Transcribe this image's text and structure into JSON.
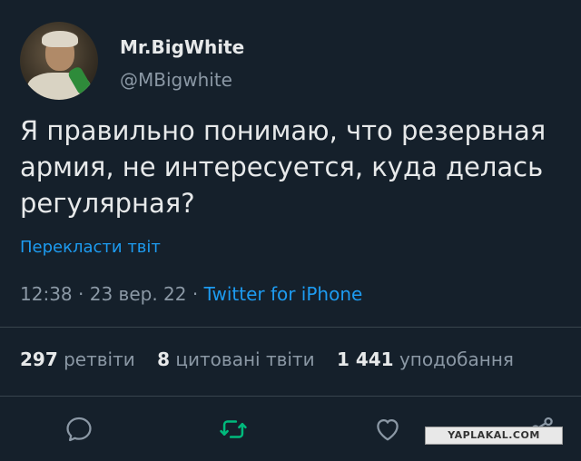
{
  "author": {
    "display_name": "Mr.BigWhite",
    "handle": "@MBigwhite"
  },
  "tweet": {
    "text": "Я правильно понимаю, что резервная армия, не интересуется, куда делась регулярная?",
    "translate_label": "Перекласти твіт",
    "time": "12:38",
    "date": "23 вер. 22",
    "separator": "·",
    "source": "Twitter for iPhone"
  },
  "stats": {
    "retweets_count": "297",
    "retweets_label": "ретвіти",
    "quotes_count": "8",
    "quotes_label": "цитовані твіти",
    "likes_count": "1 441",
    "likes_label": "уподобання"
  },
  "actions": {
    "icons": [
      "reply-icon",
      "retweet-icon",
      "like-icon",
      "share-icon"
    ]
  },
  "watermark": "YAPLAKAL.COM",
  "colors": {
    "background": "#15202b",
    "text": "#e7e9ea",
    "secondary": "#8b98a5",
    "accent": "#1d9bf0",
    "retweet": "#00ba7c"
  }
}
